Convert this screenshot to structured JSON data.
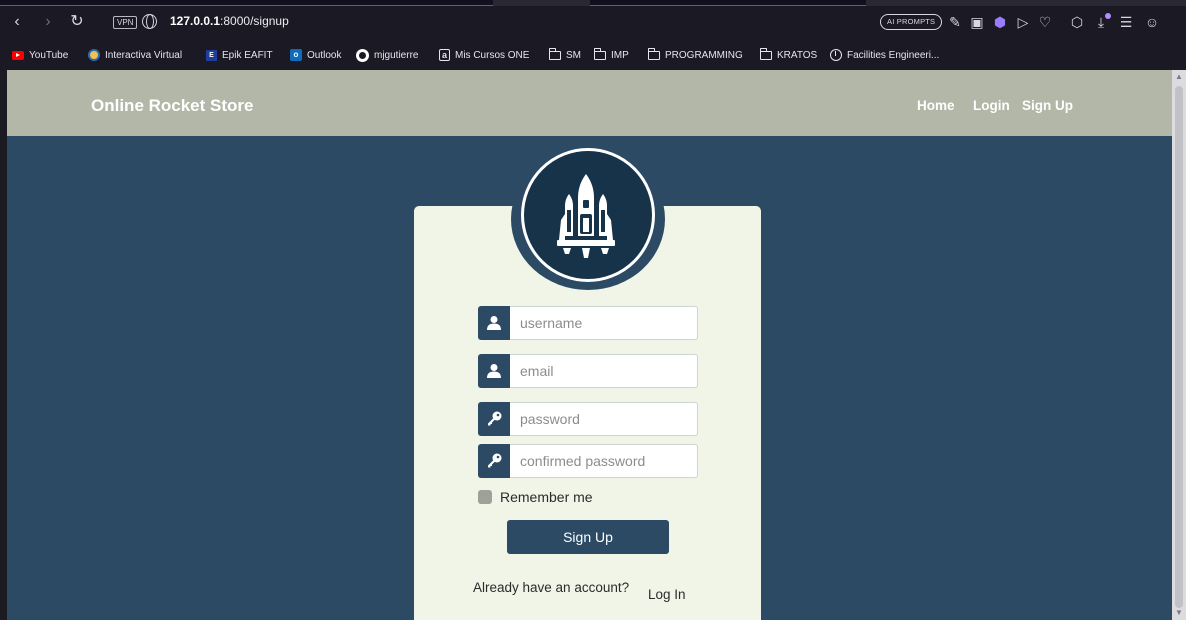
{
  "browser": {
    "url_host": "127.0.0.1",
    "url_rest": ":8000/signup",
    "vpn_badge": "VPN",
    "ai_prompts_label": "AI PROMPTS",
    "bookmarks": [
      {
        "label": "YouTube",
        "icon": "youtube-icon"
      },
      {
        "label": "Interactiva Virtual",
        "icon": "sun-icon"
      },
      {
        "label": "Epik EAFIT",
        "icon": "epik-icon"
      },
      {
        "label": "Outlook",
        "icon": "outlook-icon"
      },
      {
        "label": "mjgutierre",
        "icon": "github-icon"
      },
      {
        "label": "Mis Cursos ONE",
        "icon": "a-icon"
      },
      {
        "label": "SM",
        "icon": "folder-icon"
      },
      {
        "label": "IMP",
        "icon": "folder-icon"
      },
      {
        "label": "PROGRAMMING",
        "icon": "folder-icon"
      },
      {
        "label": "KRATOS",
        "icon": "folder-icon"
      },
      {
        "label": "Facilities Engineeri...",
        "icon": "mercedes-icon"
      }
    ]
  },
  "navbar": {
    "brand": "Online Rocket Store",
    "links": [
      "Home",
      "Login",
      "Sign Up"
    ]
  },
  "form": {
    "username_placeholder": "username",
    "email_placeholder": "email",
    "password_placeholder": "password",
    "confirm_placeholder": "confirmed password",
    "remember_label": "Remember me",
    "submit_label": "Sign Up",
    "already_text": "Already have an account?",
    "login_link": "Log In"
  },
  "colors": {
    "page_bg": "#2c4a64",
    "navbar_bg": "#b3b7a8",
    "card_bg": "#f0f5e8",
    "logo_bg": "#163349",
    "accent": "#2c4a64"
  }
}
